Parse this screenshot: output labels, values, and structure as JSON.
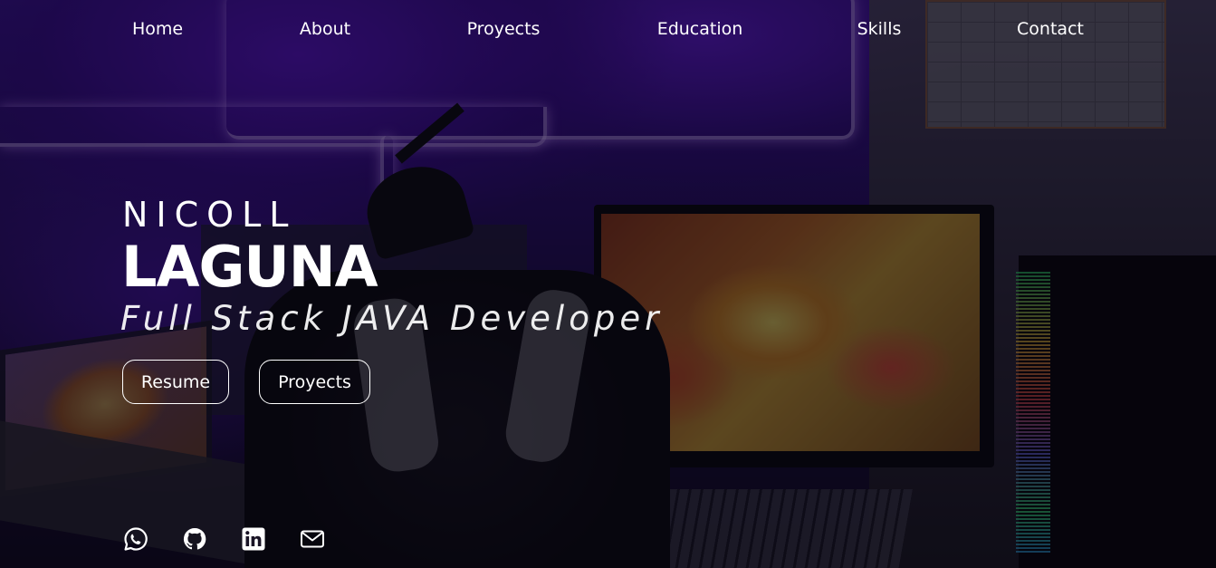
{
  "nav": {
    "items": [
      {
        "label": "Home"
      },
      {
        "label": "About"
      },
      {
        "label": "Proyects"
      },
      {
        "label": "Education"
      },
      {
        "label": "Skills"
      },
      {
        "label": "Contact"
      }
    ]
  },
  "hero": {
    "first_name": "NICOLL",
    "last_name": "LAGUNA",
    "role": "Full Stack JAVA Developer",
    "buttons": {
      "resume_label": "Resume",
      "proyects_label": "Proyects"
    }
  },
  "socials": [
    {
      "icon": "whatsapp-icon"
    },
    {
      "icon": "github-icon"
    },
    {
      "icon": "linkedin-icon"
    },
    {
      "icon": "mail-icon"
    }
  ],
  "colors": {
    "text": "#ffffff",
    "accent_purple": "#3a1596"
  }
}
